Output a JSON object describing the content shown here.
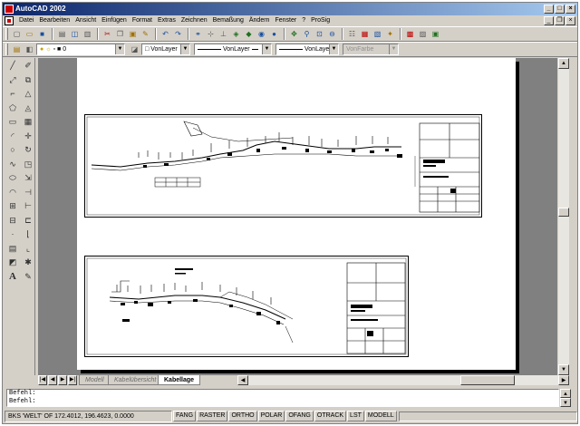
{
  "window": {
    "title": "AutoCAD 2002"
  },
  "menu": [
    "Datei",
    "Bearbeiten",
    "Ansicht",
    "Einfügen",
    "Format",
    "Extras",
    "Zeichnen",
    "Bemaßung",
    "Ändern",
    "Fenster",
    "?",
    "ProSig"
  ],
  "properties": {
    "layer": "0",
    "color": "VonLayer",
    "linetype": "VonLayer",
    "lineweight": "VonLayer",
    "plotstyle": "VonFarbe"
  },
  "tabs": [
    "Modell",
    "Kabelübersicht",
    "Kabellage"
  ],
  "active_tab": "Kabellage",
  "command": {
    "line1": "Befehl:",
    "line2": "Befehl:"
  },
  "status": {
    "coords": "BKS 'WELT' OF  172.4012, 196.4623, 0.0000",
    "buttons": [
      "FANG",
      "RASTER",
      "ORTHO",
      "POLAR",
      "OFANG",
      "OTRACK",
      "LST",
      "MODELL"
    ]
  },
  "icons": {
    "titlebar": [
      "autocad-app-icon",
      "minimize-icon",
      "maximize-icon",
      "close-icon"
    ],
    "standard_toolbar": [
      "new-icon",
      "open-icon",
      "save-icon",
      "print-icon",
      "preview-icon",
      "plot-icon",
      "cut-icon",
      "copy-icon",
      "paste-icon",
      "match-icon",
      "undo-icon",
      "redo-icon",
      "hyperlink-icon",
      "osnap-icon",
      "ucs-icon",
      "pan-icon",
      "zoom-realtime-icon",
      "zoom-window-icon",
      "zoom-previous-icon",
      "properties-icon",
      "designcenter-icon",
      "help-icon"
    ],
    "draw_tools": [
      "line-icon",
      "construction-line-icon",
      "polyline-icon",
      "polygon-icon",
      "rectangle-icon",
      "arc-icon",
      "circle-icon",
      "spline-icon",
      "ellipse-icon",
      "insert-block-icon",
      "make-block-icon",
      "point-icon",
      "hatch-icon",
      "region-icon",
      "text-icon"
    ],
    "modify_tools": [
      "erase-icon",
      "copy-object-icon",
      "mirror-icon",
      "offset-icon",
      "array-icon",
      "move-icon",
      "rotate-icon",
      "scale-icon",
      "stretch-icon",
      "trim-icon",
      "extend-icon",
      "break-icon",
      "chamfer-icon",
      "fillet-icon",
      "explode-icon"
    ]
  }
}
